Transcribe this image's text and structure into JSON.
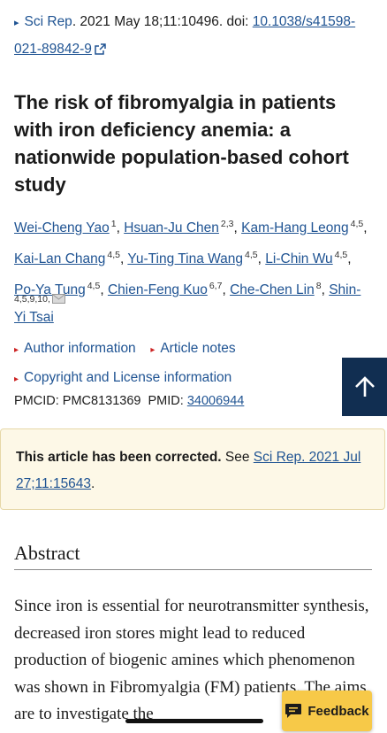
{
  "citation": {
    "journal": "Sci Rep",
    "details": ". 2021 May 18;11:10496. doi: ",
    "doi": "10.1038/s41598-021-89842-9"
  },
  "title": "The risk of fibromyalgia in patients with iron deficiency anemia: a nationwide population-based cohort study",
  "authors": [
    {
      "name": "Wei-Cheng Yao",
      "sup": "1"
    },
    {
      "name": "Hsuan-Ju Chen",
      "sup": "2,3"
    },
    {
      "name": "Kam-Hang Leong",
      "sup": "4,5"
    },
    {
      "name": "Kai-Lan Chang",
      "sup": "4,5"
    },
    {
      "name": "Yu-Ting Tina Wang",
      "sup": "4,5"
    },
    {
      "name": "Li-Chin Wu",
      "sup": "4,5"
    },
    {
      "name": "Po-Ya Tung",
      "sup": "4,5"
    },
    {
      "name": "Chien-Feng Kuo",
      "sup": "6,7"
    },
    {
      "name": "Che-Chen Lin",
      "sup": "8"
    },
    {
      "name": "Shin-Yi Tsai",
      "sup": "4,5,9,10,"
    }
  ],
  "links": {
    "author_info": "Author information",
    "article_notes": "Article notes",
    "copyright": "Copyright and License information"
  },
  "ids": {
    "pmcid_label": "PMCID: ",
    "pmcid": "PMC8131369",
    "pmid_label": "PMID: ",
    "pmid": "34006944"
  },
  "correction": {
    "bold": "This article has been corrected.",
    "see": " See ",
    "link": "Sci Rep. 2021 Jul 27;11:15643",
    "end": "."
  },
  "abstract": {
    "heading": "Abstract",
    "text": "Since iron is essential for neurotransmitter synthesis, decreased iron stores might lead to reduced production of biogenic amines which phenomenon was shown in Fibromyalgia (FM) patients. The aims are to investigate the"
  },
  "feedback_label": "Feedback",
  "colors": {
    "link": "#205493",
    "navy": "#112e51",
    "feedback": "#f7c948",
    "correction_bg": "#fdf8e7"
  },
  "icons": [
    "external-link-icon",
    "email-icon",
    "arrow-up-icon",
    "feedback-chat-icon"
  ]
}
